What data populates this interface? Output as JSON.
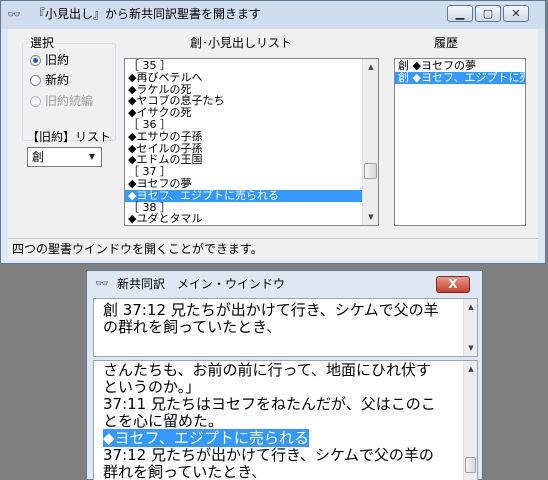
{
  "window1": {
    "title": "『小見出し』から新共同訳聖書を開きます",
    "icon": "book-glasses-icon",
    "select_group": {
      "legend": "選択",
      "options": [
        {
          "label": "旧約",
          "checked": true,
          "enabled": true
        },
        {
          "label": "新約",
          "checked": false,
          "enabled": true
        },
        {
          "label": "旧約続編",
          "checked": false,
          "enabled": false
        }
      ]
    },
    "list_label": "【旧約】リスト",
    "book_combo": {
      "value": "創"
    },
    "headings_list": {
      "label": "創･小見出しリスト",
      "items": [
        "［ 35 ］",
        "◆再びベテルへ",
        "◆ラケルの死",
        "◆ヤコブの息子たち",
        "◆イサクの死",
        "［ 36 ］",
        "◆エサウの子孫",
        "◆セイルの子孫",
        "◆エドムの王国",
        "［ 37 ］",
        "◆ヨセフの夢",
        "◆ヨセフ、エジプトに売られる",
        "［ 38 ］",
        "◆ユダとタマル"
      ],
      "selected_index": 11
    },
    "history_list": {
      "label": "履歴",
      "items": [
        "創 ◆ヨセフの夢",
        "創 ◆ヨセフ、エジプトに売られる"
      ],
      "selected_index": 1
    },
    "status_text": "四つの聖書ウインドウを開くことができます。"
  },
  "window2": {
    "title": "新共同訳　メイン・ウインドウ",
    "close_label": "X",
    "top_pane_lines": [
      "創 37:12 兄たちが出かけて行き、シケムで父の羊",
      "の群れを飼っていたとき、"
    ],
    "bottom_pane_lines": [
      "さんたちも、お前の前に行って、地面にひれ伏す",
      "というのか。」",
      "37:11 兄たちはヨセフをねたんだが、父はこのこ",
      "とを心に留めた。",
      "◆ヨセフ、エジプトに売られる",
      "37:12 兄たちが出かけて行き、シケムで父の羊の",
      "群れを飼っていたとき、"
    ],
    "highlight_line_index": 4
  }
}
